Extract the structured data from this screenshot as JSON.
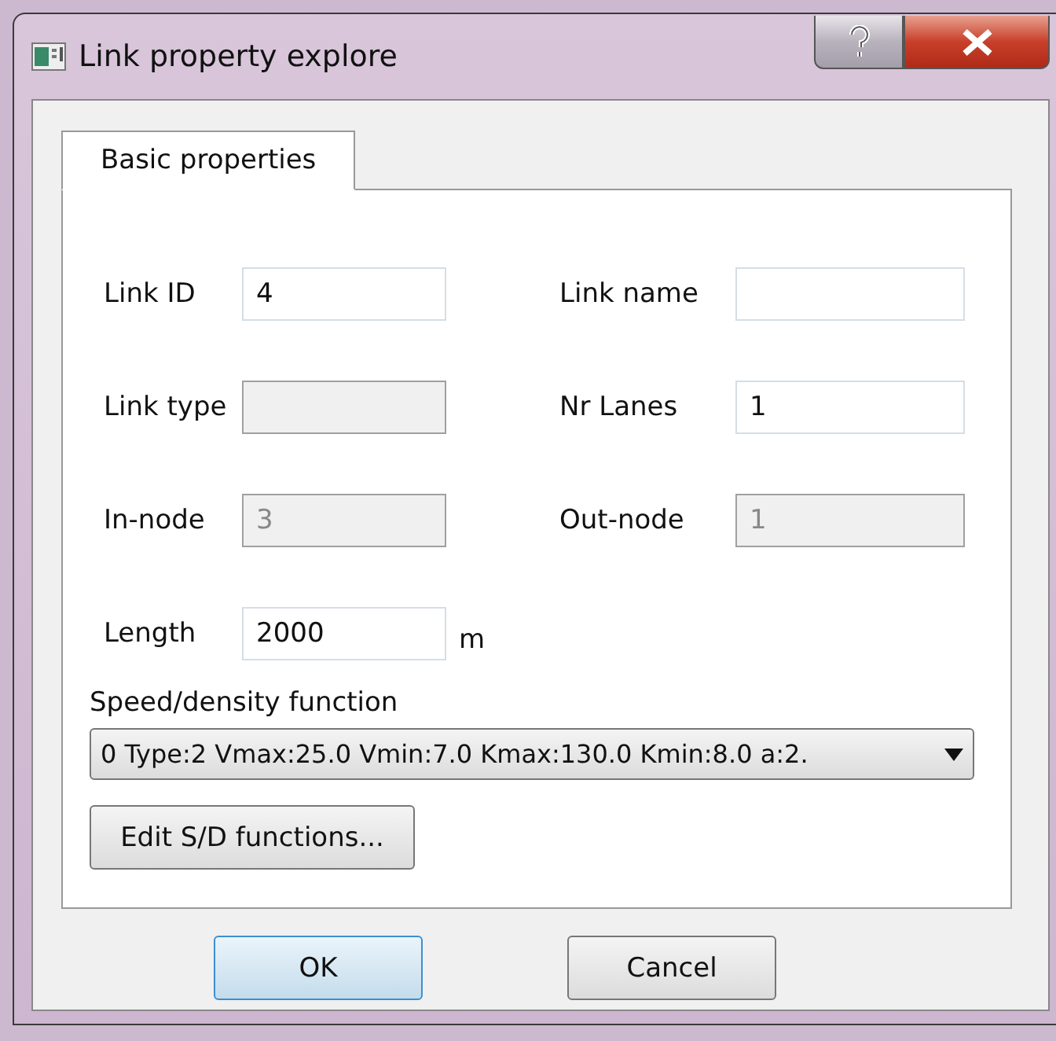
{
  "window": {
    "title": "Link property explore"
  },
  "tabs": [
    {
      "label": "Basic properties",
      "selected": true
    }
  ],
  "fields": [
    {
      "label": "Link ID",
      "value": "4",
      "disabled": false
    },
    {
      "label": "Link name",
      "disabled": false
    },
    {
      "label": "Link type",
      "disabled": true
    },
    {
      "label": "Nr Lanes",
      "value": "1",
      "disabled": false
    },
    {
      "label": "In-node",
      "value": "3",
      "disabled": true
    },
    {
      "label": "Out-node",
      "value": "1",
      "disabled": true
    },
    {
      "label": "Length",
      "value": "2000",
      "disabled": false,
      "unit": "m"
    }
  ],
  "speed_density": {
    "label": "Speed/density function",
    "value": "0  Type:2 Vmax:25.0 Vmin:7.0 Kmax:130.0 Kmin:8.0 a:2.",
    "edit_button": "Edit S/D functions..."
  },
  "buttons": [
    {
      "label": "OK",
      "default": true
    },
    {
      "label": "Cancel",
      "default": false
    }
  ]
}
